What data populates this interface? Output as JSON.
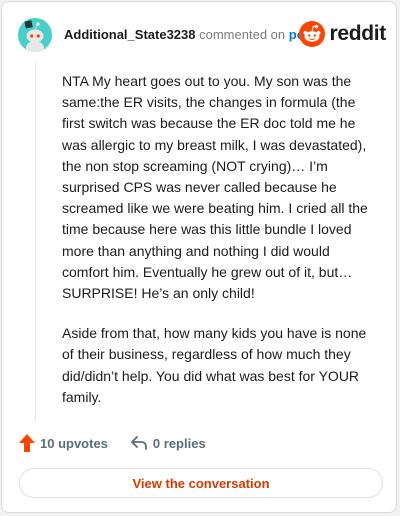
{
  "header": {
    "username": "Additional_State3238",
    "action_text": "commented on",
    "post_link": "post",
    "brand": "reddit"
  },
  "comment": {
    "paragraphs": [
      "NTA My heart goes out to you. My son was the same:the ER visits, the changes in formula (the first switch was because the ER doc told me he was allergic to my breast milk, I was devastated), the non stop screaming (NOT crying)… I’m surprised CPS was never called because he screamed like we were beating him. I cried all the time because here was this little bundle I loved more than anything and nothing I did would comfort him. Eventually he grew out of it, but… SURPRISE! He’s an only child!",
      "Aside from that, how many kids you have is none of their business, regardless of how much they did/didn’t help. You did what was best for YOUR family."
    ]
  },
  "actions": {
    "upvotes": "10 upvotes",
    "replies": "0 replies"
  },
  "cta": {
    "label": "View the conversation"
  },
  "colors": {
    "accent": "#ff4500",
    "link": "#0079d3",
    "avatar_bg": "#46d0c9",
    "cta_text": "#d93a00"
  },
  "icons": {
    "avatar": "snoo-avatar-icon",
    "brand": "reddit-logo-icon",
    "upvote": "upvote-arrow-icon",
    "reply": "reply-arrow-icon"
  }
}
